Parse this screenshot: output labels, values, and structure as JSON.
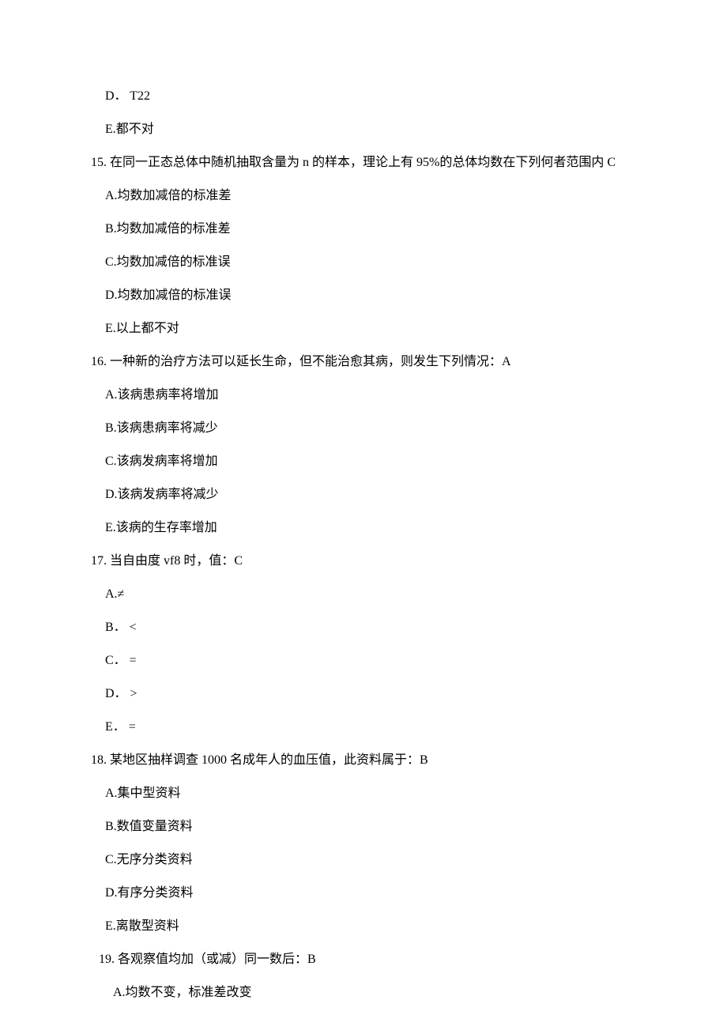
{
  "pre_options": {
    "d": "D． T22",
    "e": "E.都不对"
  },
  "q15": {
    "text": "15. 在同一正态总体中随机抽取含量为 n 的样本，理论上有 95%的总体均数在下列何者范围内 C",
    "a": "A.均数加减倍的标准差",
    "b": "B.均数加减倍的标准差",
    "c": "C.均数加减倍的标准误",
    "d": "D.均数加减倍的标准误",
    "e": "E.以上都不对"
  },
  "q16": {
    "text": "16. 一种新的治疗方法可以延长生命，但不能治愈其病，则发生下列情况：A",
    "a": "A.该病患病率将增加",
    "b": "B.该病患病率将减少",
    "c": "C.该病发病率将增加",
    "d": "D.该病发病率将减少",
    "e": "E.该病的生存率增加"
  },
  "q17": {
    "text": "17. 当自由度 vf8 时，值：C",
    "a": "A.≠",
    "b": "B． <",
    "c": "C． =",
    "d": "D． >",
    "e": "E． ="
  },
  "q18": {
    "text": "18. 某地区抽样调查 1000 名成年人的血压值，此资料属于：B",
    "a": "A.集中型资料",
    "b": "B.数值变量资料",
    "c": "C.无序分类资料",
    "d": "D.有序分类资料",
    "e": "E.离散型资料"
  },
  "q19": {
    "text": "19. 各观察值均加（或减）同一数后：B",
    "a": "A.均数不变，标准差改变"
  }
}
